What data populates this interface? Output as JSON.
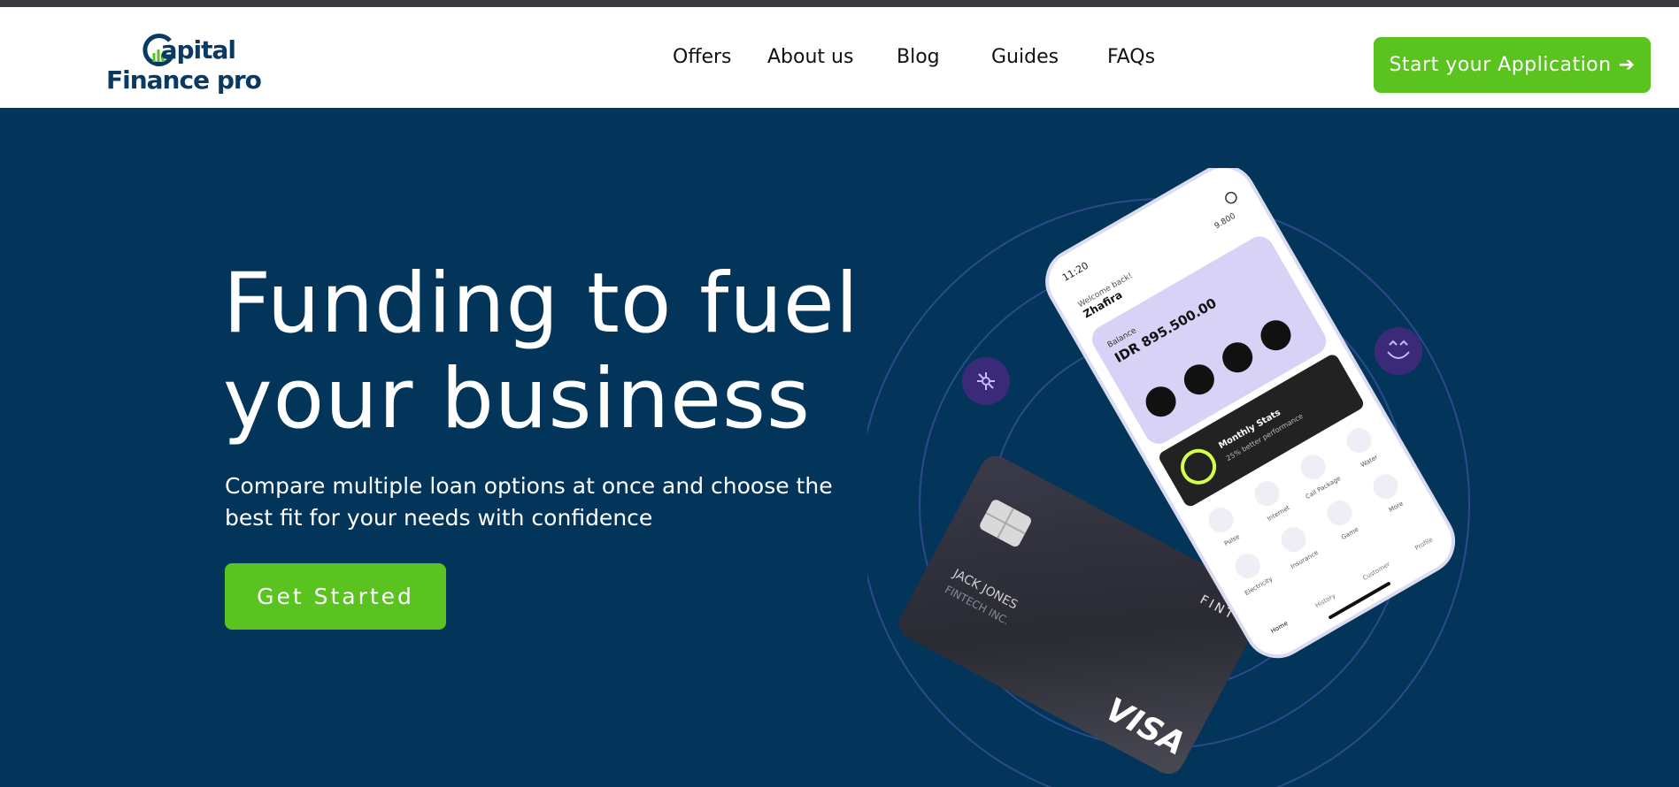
{
  "brand": {
    "logo_line1": "apital",
    "logo_letter": "C",
    "logo_line2": "Finance pro",
    "primary_color": "#0a3a63",
    "accent_color": "#5ac31f",
    "hero_bg": "#03345a"
  },
  "nav": {
    "items": [
      {
        "label": "Offers"
      },
      {
        "label": "About us"
      },
      {
        "label": "Blog"
      },
      {
        "label": "Guides"
      },
      {
        "label": "FAQs"
      }
    ],
    "cta_label": "Start your Application",
    "cta_icon": "arrow-right-icon"
  },
  "hero": {
    "title_line1": "Funding to fuel",
    "title_line2": "your business",
    "subtitle_line1": "Compare multiple loan options at once and choose the",
    "subtitle_line2": "best fit for your needs with confidence",
    "button_label": "Get Started"
  },
  "phone": {
    "time": "11:20",
    "welcome": "Welcome back!",
    "user": "Zhafira",
    "points": "9.800",
    "balance_label": "Balance",
    "balance_value": "IDR 895.500.00",
    "stats_title": "Monthly Stats",
    "stats_sub": "25% better performance",
    "services": [
      "Water",
      "Call Package",
      "Internet",
      "Pulse",
      "More",
      "Game",
      "Insurance",
      "Electricity"
    ],
    "tabs": [
      "Home",
      "History",
      "Customer",
      "Profile"
    ]
  },
  "card": {
    "holder": "JACK JONES",
    "company": "FINTECH INC.",
    "brand_mark": "FINT",
    "network": "VISA"
  },
  "icons": {
    "left_bubble": "network-icon",
    "right_bubble": "heart-hand-icon"
  }
}
